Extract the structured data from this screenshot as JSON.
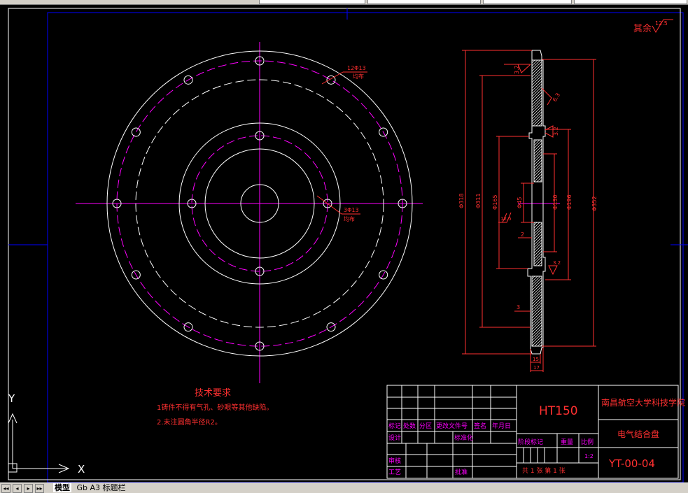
{
  "tabs": [
    "模型",
    "Gb A3 标题栏"
  ],
  "nav_buttons": [
    "◂◂",
    "◂",
    "▸",
    "▸▸"
  ],
  "ucs": {
    "x": "X",
    "y": "Y"
  },
  "roughness_other": {
    "label": "其余",
    "value": "12.5"
  },
  "tech_requirements": {
    "title": "技术要求",
    "items": [
      "1铸件不得有气孔、砂眼等其他缺陷。",
      "2.未注圆角半径R2。"
    ]
  },
  "front_view_labels": {
    "hole_12": "12Φ13",
    "hole_12_note": "均布",
    "hole_3": "3Φ13",
    "hole_3_note": "均布"
  },
  "section_dims": {
    "d318": "Φ318",
    "d311": "Φ311",
    "d165": "Φ165",
    "d45": "Φ45",
    "d130": "Φ130",
    "d196": "Φ196",
    "d352": "Φ352",
    "r32a": "3.2",
    "r63": "6.3",
    "r32b": "3.2",
    "r125": "12.5",
    "r32c": "3.2",
    "dim_2": "2",
    "dim_3": "3",
    "dim_15": "15",
    "dim_17": "17"
  },
  "title_block": {
    "material": "HT150",
    "school": "南昌航空大学科技学院",
    "part_name": "电气结合盘",
    "part_code": "YT-00-04",
    "scale_label": "比例",
    "scale_value": "1:2",
    "stage_mark": "阶段标记",
    "weight": "重量",
    "sheets": "共 1 张 第 1 张",
    "row_labels": [
      "标记",
      "处数",
      "分区",
      "更改文件号",
      "签名",
      "年月日"
    ],
    "designer": "设计",
    "standardize": "标准化",
    "audit": "审核",
    "process": "工艺",
    "approve": "批准"
  },
  "colors": {
    "background": "#000000",
    "white": "#ffffff",
    "magenta": "#ff00ff",
    "red": "#ff3030",
    "blue": "#0000ff"
  }
}
